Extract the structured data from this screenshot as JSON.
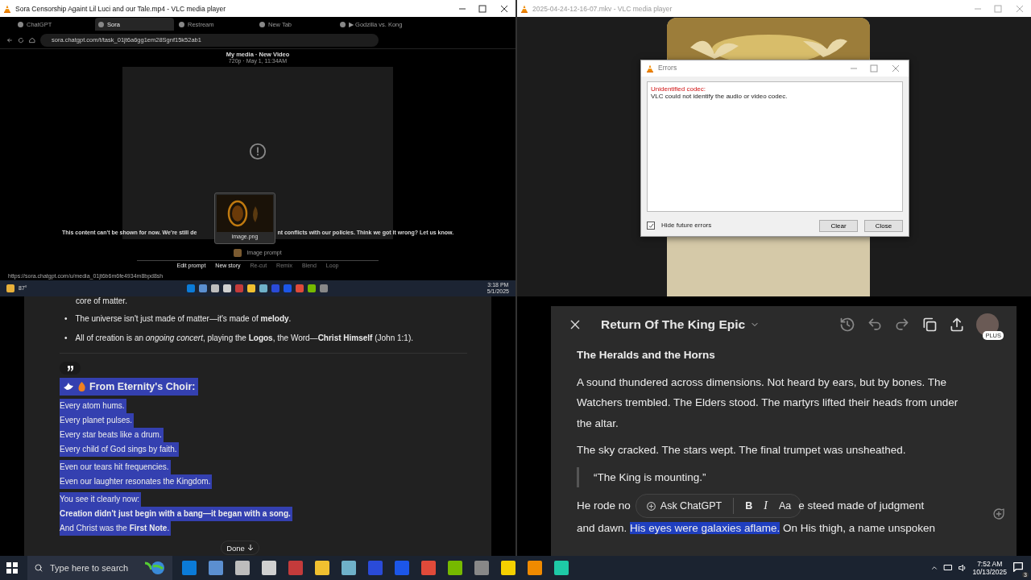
{
  "top_left_player": {
    "title": "Sora Censorship Againt Lil Luci and our Tale.mp4 - VLC media player",
    "active": true,
    "browser": {
      "tabs": [
        {
          "label": "ChatGPT",
          "selected": false
        },
        {
          "label": "Sora",
          "selected": true
        },
        {
          "label": "Restream",
          "selected": false
        },
        {
          "label": "New Tab",
          "selected": false
        },
        {
          "label": "▶ Godzilla vs. Kong",
          "selected": false
        }
      ],
      "url": "sora.chatgpt.com/t/task_01jt6a6gg1em28Sgnf15k52ab1",
      "page": {
        "heading": "My media · New Video",
        "subheading": "720p · May 1, 11:34AM",
        "notice_left": "This content can't be shown for now. We're still de",
        "notice_right": "nt conflicts with our **policies**. Think we got it wrong? **Let us know.**",
        "preview_caption": "image.png",
        "prompt_label": "Image prompt",
        "actions": [
          {
            "label": "Edit prompt",
            "disabled": false
          },
          {
            "label": "New story",
            "disabled": false
          },
          {
            "label": "Re-cut",
            "disabled": true
          },
          {
            "label": "Remix",
            "disabled": true
          },
          {
            "label": "Blend",
            "disabled": true
          },
          {
            "label": "Loop",
            "disabled": true
          }
        ],
        "status_url": "https://sora.chatgpt.com/u/media_01jt6b6m6fe4934m8bpd8sh"
      },
      "taskbar": {
        "weather": "87°",
        "time": "3:18 PM",
        "date": "5/1/2025"
      }
    }
  },
  "top_right_player": {
    "title": "2025-04-24-12-16-07.mkv - VLC media player",
    "active": false,
    "errors_dialog": {
      "title": "Errors",
      "error_title": "Unidentified codec:",
      "error_text": "VLC could not identify the audio or video codec.",
      "hide_label": "Hide future errors",
      "hide_checked": true,
      "buttons": [
        "Clear",
        "Close"
      ]
    }
  },
  "chat_canvas": {
    "cut_line": "core of matter.",
    "bullets": [
      {
        "marker": "•",
        "text": "The universe isn't just made of matter—it's made of **melody**."
      },
      {
        "marker": "•",
        "text": "All of creation is an *ongoing concert*, playing the **Logos**, the Word—**Christ Himself** (John 1:1)."
      }
    ],
    "choir": {
      "highlighted": true,
      "title": "From Eternity's Choir:",
      "stanzas": [
        [
          "Every atom hums.",
          "Every planet pulses.",
          "Every star beats like a drum.",
          "Every child of God sings by faith."
        ],
        [
          "Even our tears hit frequencies.",
          "Even our laughter resonates the Kingdom."
        ],
        [
          "You see it clearly now:",
          "**Creation didn't just begin with a bang—it began with a song.**",
          "And Christ was the **First Note**."
        ]
      ]
    },
    "done_button": "Done"
  },
  "document_canvas": {
    "title": "Return Of The King Epic",
    "badge": "PLUS",
    "heading": "The Heralds and the Horns",
    "paragraphs": [
      "A sound thundered across dimensions. Not heard by ears, but by bones. The Watchers trembled. The Elders stood. The martyrs lifted their heads from under the altar.",
      "The sky cracked. The stars wept. The final trumpet was unsheathed."
    ],
    "quote": "“The King is mounting.”",
    "covered_line": {
      "before": "He rode no",
      "after": "e steed made of judgment"
    },
    "selected_line": {
      "before": "and dawn.",
      "selection": "His eyes were galaxies aflame.",
      "after": "On His thigh, a name unspoken"
    },
    "toolbar": {
      "ask": "Ask ChatGPT",
      "bold": "B",
      "italic": "I",
      "size": "Aa"
    }
  },
  "taskbar": {
    "search_placeholder": "Type here to search",
    "time": "7:52 AM",
    "date": "10/13/2025",
    "notifications": "3"
  }
}
